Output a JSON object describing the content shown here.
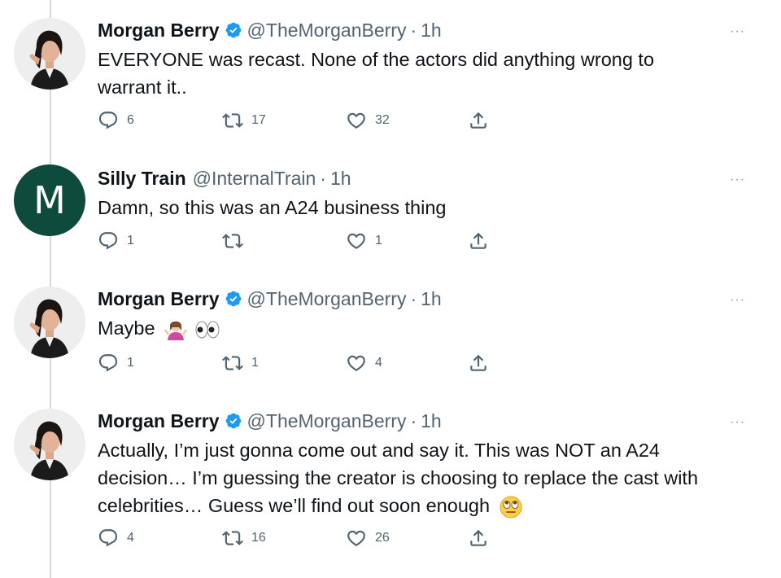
{
  "tweets": [
    {
      "name": "Morgan Berry",
      "handle": "@TheMorganBerry",
      "time": "1h",
      "text_lines": [
        "EVERYONE was recast. None of the actors did anything wrong to",
        "warrant it.."
      ],
      "replies": "6",
      "retweets": "17",
      "likes": "32",
      "verified": true,
      "avatar_icon": "woman-portrait"
    },
    {
      "name": "Silly Train",
      "handle": "@InternalTrain",
      "time": "1h",
      "text_lines": [
        "Damn, so this was an A24 business thing"
      ],
      "replies": "1",
      "retweets": "",
      "likes": "1",
      "verified": false,
      "avatar_letter": "M"
    },
    {
      "name": "Morgan Berry",
      "handle": "@TheMorganBerry",
      "time": "1h",
      "text_lines": [
        "Maybe"
      ],
      "emojis": [
        "person-shrugging-emoji",
        "eyes-emoji"
      ],
      "replies": "1",
      "retweets": "1",
      "likes": "4",
      "verified": true,
      "avatar_icon": "woman-portrait"
    },
    {
      "name": "Morgan Berry",
      "handle": "@TheMorganBerry",
      "time": "1h",
      "text_lines": [
        "Actually, I’m just gonna come out and say it. This was NOT an A24",
        "decision… I’m guessing the creator is choosing to replace the cast with",
        "celebrities… Guess we’ll find out soon enough"
      ],
      "emojis": [
        "rolling-eyes-emoji"
      ],
      "replies": "4",
      "retweets": "16",
      "likes": "26",
      "verified": true,
      "avatar_icon": "woman-portrait"
    }
  ],
  "separator": "·",
  "more_glyph": "···",
  "colors": {
    "accent": "#1d9bf0",
    "muted": "#536471",
    "avatar_green": "#0f4b3c"
  }
}
